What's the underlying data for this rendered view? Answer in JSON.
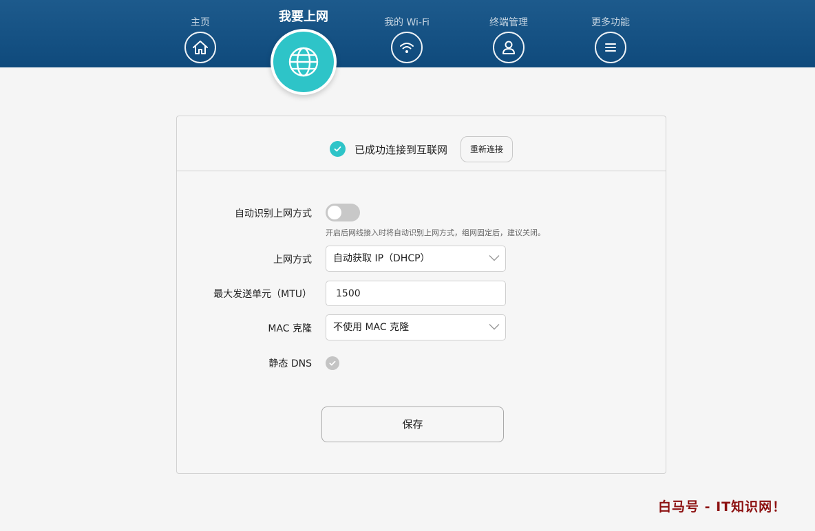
{
  "nav": {
    "items": [
      {
        "label": "主页",
        "icon": "home-icon"
      },
      {
        "label": "我要上网",
        "icon": "globe-icon",
        "active": true
      },
      {
        "label": "我的 Wi-Fi",
        "icon": "wifi-icon"
      },
      {
        "label": "终端管理",
        "icon": "user-icon"
      },
      {
        "label": "更多功能",
        "icon": "menu-icon"
      }
    ]
  },
  "colors": {
    "header": "#15558a",
    "accent": "#2ec4c8",
    "watermark": "#8c1010"
  },
  "status": {
    "text": "已成功连接到互联网",
    "reconnect_label": "重新连接"
  },
  "form": {
    "auto_detect": {
      "label": "自动识别上网方式",
      "enabled": false,
      "hint": "开启后网线接入时将自动识别上网方式，组网固定后，建议关闭。"
    },
    "connection_type": {
      "label": "上网方式",
      "value": "自动获取 IP（DHCP）"
    },
    "mtu": {
      "label": "最大发送单元（MTU）",
      "value": "1500"
    },
    "mac_clone": {
      "label": "MAC 克隆",
      "value": "不使用 MAC 克隆"
    },
    "static_dns": {
      "label": "静态 DNS",
      "checked": false
    },
    "save_label": "保存"
  },
  "watermark": "白马号 - IT知识网！"
}
